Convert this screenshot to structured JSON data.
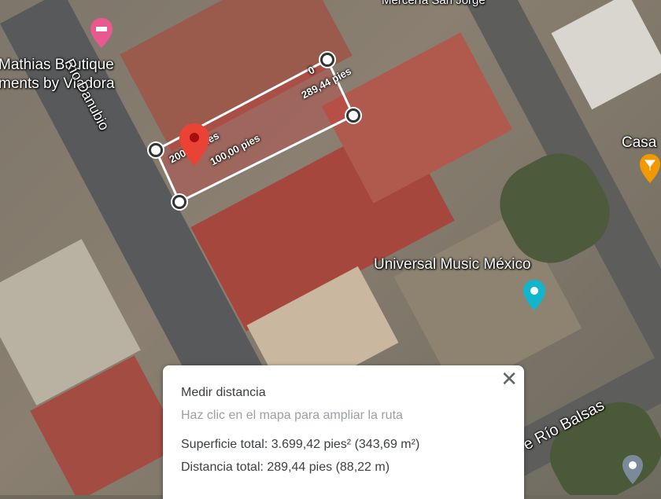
{
  "map_labels": {
    "merceria": "Mercería San Jorge",
    "mathias": "Mathias Boutique",
    "viadora": "ments by Viadora",
    "danubio": "Río Danubio",
    "casa": "Casa",
    "universal": "Universal Music México",
    "balsas": "e Río Balsas"
  },
  "measure_labels": {
    "top": "0",
    "long": "289,44 pies",
    "side1": "200,00 pies",
    "side2": "100,00 pies"
  },
  "panel": {
    "title": "Medir distancia",
    "hint": "Haz clic en el mapa para ampliar la ruta",
    "area": "Superficie total: 3.699,42 pies² (343,69 m²)",
    "distance": "Distancia total: 289,44 pies (88,22 m)",
    "close": "✕"
  },
  "colors": {
    "pin_red": "#ea4335",
    "hotel_pink": "#e8598f",
    "music_teal": "#12b5cb",
    "bar_orange": "#f29900"
  }
}
